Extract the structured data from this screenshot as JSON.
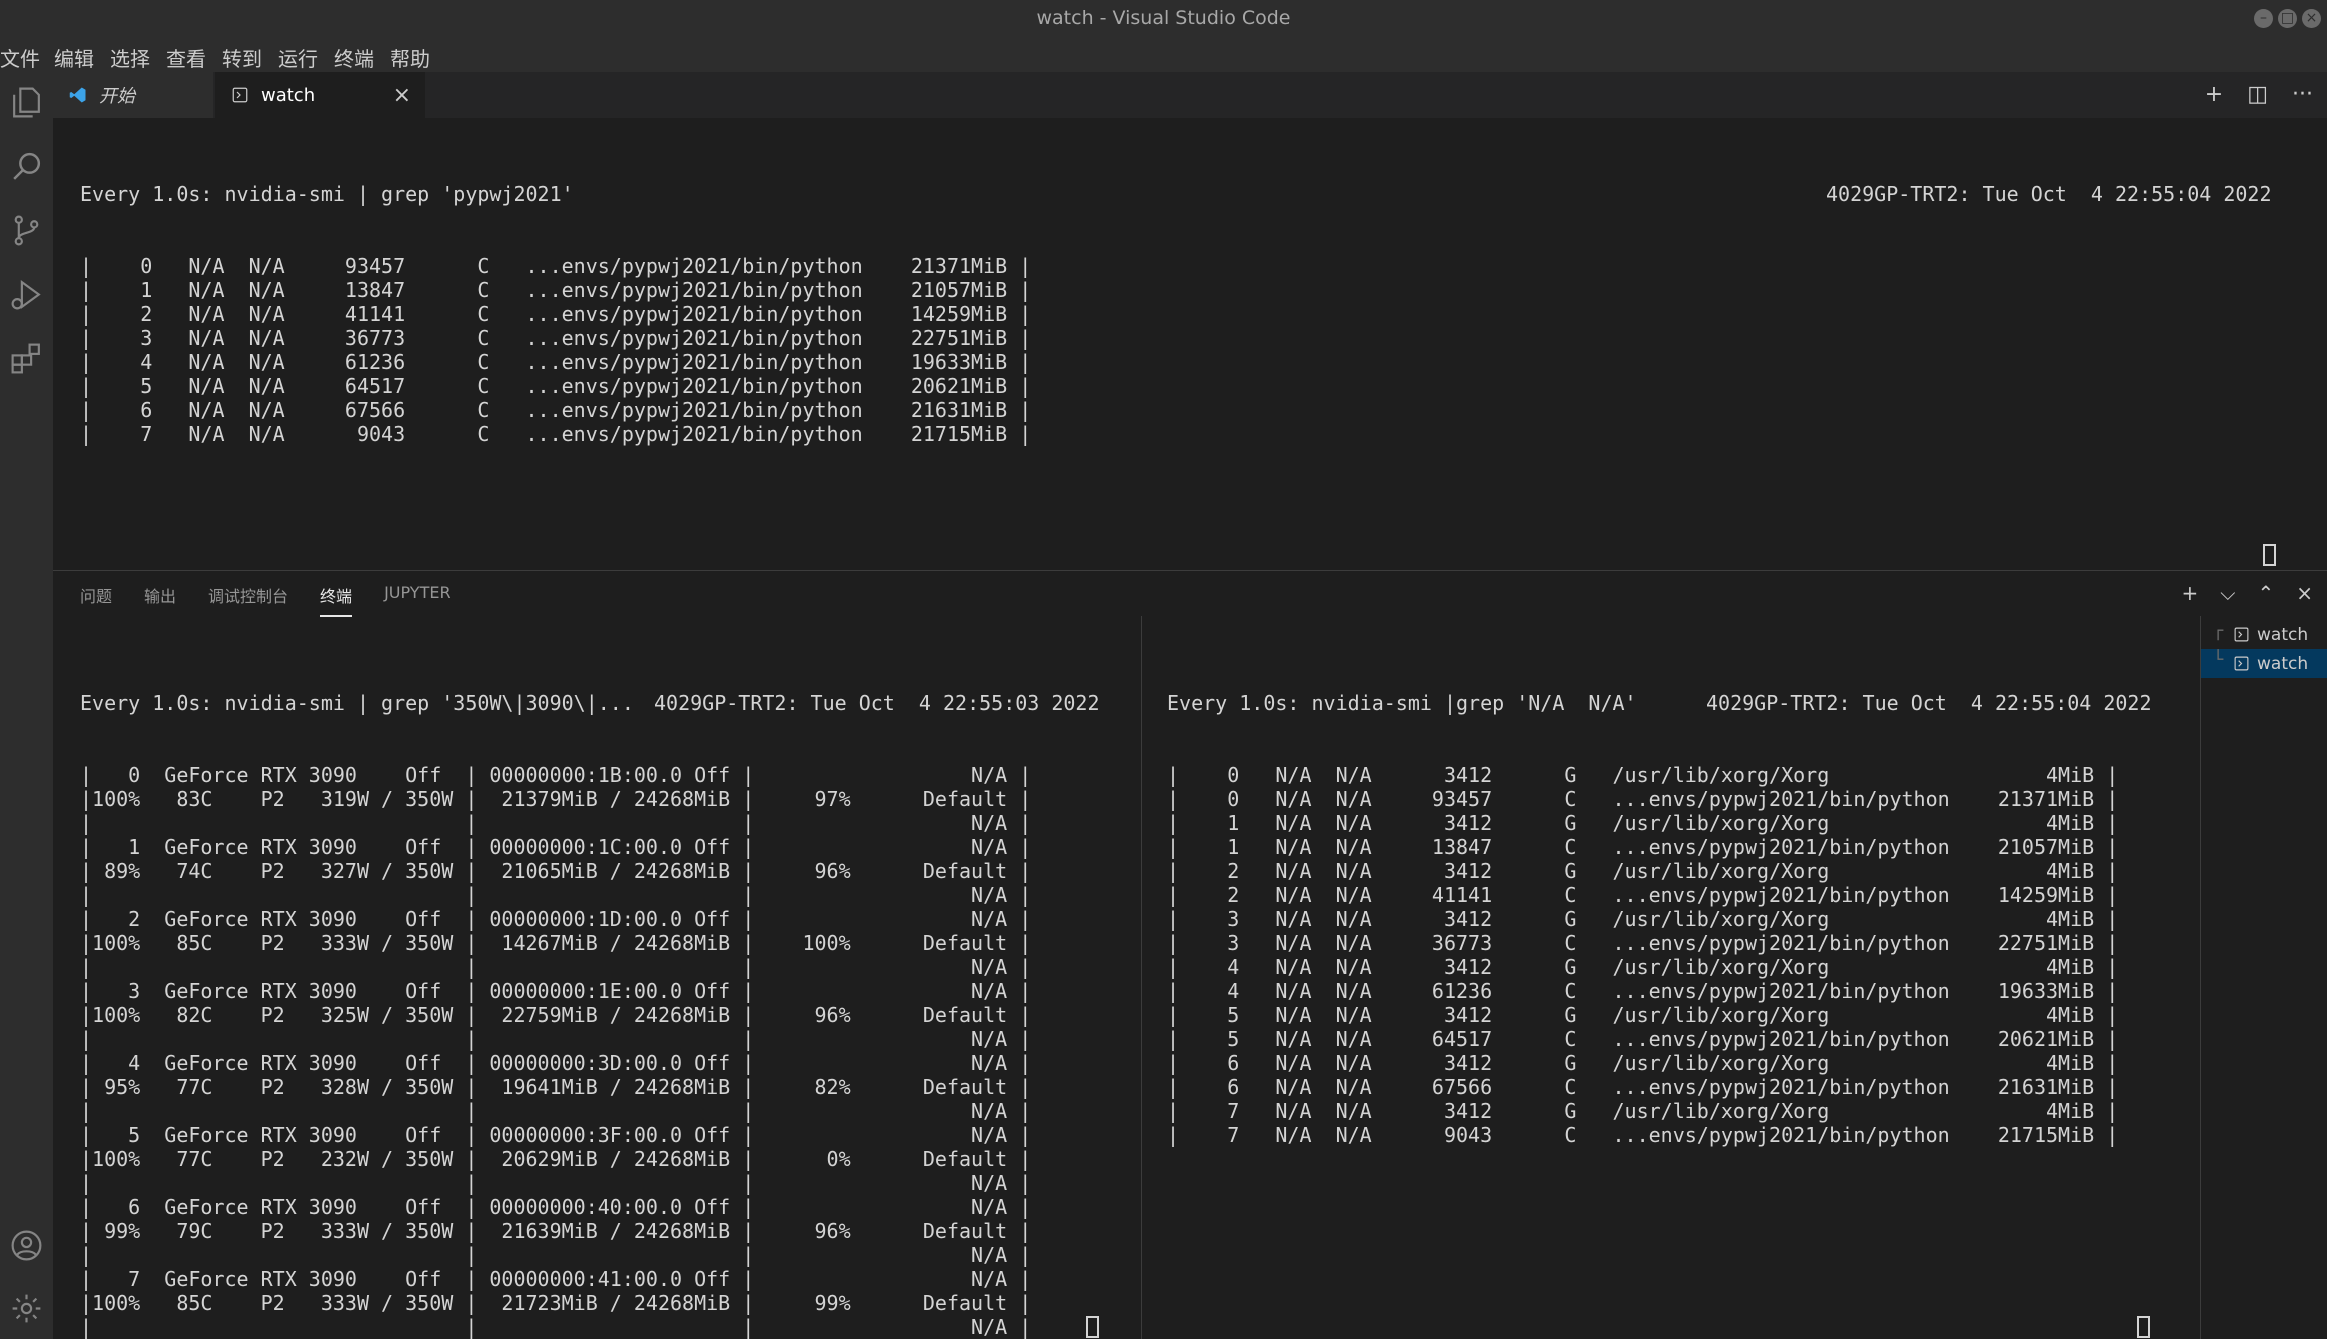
{
  "window": {
    "title": "watch - Visual Studio Code"
  },
  "menu": [
    "文件",
    "编辑",
    "选择",
    "查看",
    "转到",
    "运行",
    "终端",
    "帮助"
  ],
  "activity_icons": [
    "files-icon",
    "search-icon",
    "source-control-icon",
    "run-debug-icon",
    "extensions-icon",
    "account-icon",
    "settings-gear-icon"
  ],
  "tabs": {
    "start": "开始",
    "watch": "watch",
    "close_glyph": "×"
  },
  "tabbar_actions": {
    "add": "+",
    "chevron": "⌵",
    "split": "◫",
    "more": "···"
  },
  "editor_terminal": {
    "header_left": "Every 1.0s: nvidia-smi | grep 'pypwj2021'",
    "header_right": "4029GP-TRT2: Tue Oct  4 22:55:04 2022",
    "lines": [
      "|    0   N/A  N/A     93457      C   ...envs/pypwj2021/bin/python    21371MiB |",
      "|    1   N/A  N/A     13847      C   ...envs/pypwj2021/bin/python    21057MiB |",
      "|    2   N/A  N/A     41141      C   ...envs/pypwj2021/bin/python    14259MiB |",
      "|    3   N/A  N/A     36773      C   ...envs/pypwj2021/bin/python    22751MiB |",
      "|    4   N/A  N/A     61236      C   ...envs/pypwj2021/bin/python    19633MiB |",
      "|    5   N/A  N/A     64517      C   ...envs/pypwj2021/bin/python    20621MiB |",
      "|    6   N/A  N/A     67566      C   ...envs/pypwj2021/bin/python    21631MiB |",
      "|    7   N/A  N/A      9043      C   ...envs/pypwj2021/bin/python    21715MiB |"
    ]
  },
  "panel": {
    "tabs": [
      "问题",
      "输出",
      "调试控制台",
      "终端",
      "JUPYTER"
    ],
    "active_tab": "终端",
    "actions": {
      "add": "+",
      "chevron": "⌵",
      "maximize": "⌃",
      "close": "×"
    }
  },
  "left_terminal": {
    "header_left": "Every 1.0s: nvidia-smi | grep '350W\\|3090\\|...",
    "header_right": "4029GP-TRT2: Tue Oct  4 22:55:03 2022",
    "gpus": [
      {
        "l1": "|   0  GeForce RTX 3090    Off  | 00000000:1B:00.0 Off |                  N/A |",
        "l2": "|100%   83C    P2   319W / 350W |  21379MiB / 24268MiB |     97%      Default |"
      },
      {
        "l1": "|   1  GeForce RTX 3090    Off  | 00000000:1C:00.0 Off |                  N/A |",
        "l2": "| 89%   74C    P2   327W / 350W |  21065MiB / 24268MiB |     96%      Default |"
      },
      {
        "l1": "|   2  GeForce RTX 3090    Off  | 00000000:1D:00.0 Off |                  N/A |",
        "l2": "|100%   85C    P2   333W / 350W |  14267MiB / 24268MiB |    100%      Default |"
      },
      {
        "l1": "|   3  GeForce RTX 3090    Off  | 00000000:1E:00.0 Off |                  N/A |",
        "l2": "|100%   82C    P2   325W / 350W |  22759MiB / 24268MiB |     96%      Default |"
      },
      {
        "l1": "|   4  GeForce RTX 3090    Off  | 00000000:3D:00.0 Off |                  N/A |",
        "l2": "| 95%   77C    P2   328W / 350W |  19641MiB / 24268MiB |     82%      Default |"
      },
      {
        "l1": "|   5  GeForce RTX 3090    Off  | 00000000:3F:00.0 Off |                  N/A |",
        "l2": "|100%   77C    P2   232W / 350W |  20629MiB / 24268MiB |      0%      Default |"
      },
      {
        "l1": "|   6  GeForce RTX 3090    Off  | 00000000:40:00.0 Off |                  N/A |",
        "l2": "| 99%   79C    P2   333W / 350W |  21639MiB / 24268MiB |     96%      Default |"
      },
      {
        "l1": "|   7  GeForce RTX 3090    Off  | 00000000:41:00.0 Off |                  N/A |",
        "l2": "|100%   85C    P2   333W / 350W |  21723MiB / 24268MiB |     99%      Default |"
      }
    ],
    "l3": "|                               |                      |                  N/A |"
  },
  "right_terminal": {
    "header_left": "Every 1.0s: nvidia-smi |grep 'N/A  N/A'",
    "header_right": "4029GP-TRT2: Tue Oct  4 22:55:04 2022",
    "lines": [
      "|    0   N/A  N/A      3412      G   /usr/lib/xorg/Xorg                  4MiB |",
      "|    0   N/A  N/A     93457      C   ...envs/pypwj2021/bin/python    21371MiB |",
      "|    1   N/A  N/A      3412      G   /usr/lib/xorg/Xorg                  4MiB |",
      "|    1   N/A  N/A     13847      C   ...envs/pypwj2021/bin/python    21057MiB |",
      "|    2   N/A  N/A      3412      G   /usr/lib/xorg/Xorg                  4MiB |",
      "|    2   N/A  N/A     41141      C   ...envs/pypwj2021/bin/python    14259MiB |",
      "|    3   N/A  N/A      3412      G   /usr/lib/xorg/Xorg                  4MiB |",
      "|    3   N/A  N/A     36773      C   ...envs/pypwj2021/bin/python    22751MiB |",
      "|    4   N/A  N/A      3412      G   /usr/lib/xorg/Xorg                  4MiB |",
      "|    4   N/A  N/A     61236      C   ...envs/pypwj2021/bin/python    19633MiB |",
      "|    5   N/A  N/A      3412      G   /usr/lib/xorg/Xorg                  4MiB |",
      "|    5   N/A  N/A     64517      C   ...envs/pypwj2021/bin/python    20621MiB |",
      "|    6   N/A  N/A      3412      G   /usr/lib/xorg/Xorg                  4MiB |",
      "|    6   N/A  N/A     67566      C   ...envs/pypwj2021/bin/python    21631MiB |",
      "|    7   N/A  N/A      3412      G   /usr/lib/xorg/Xorg                  4MiB |",
      "|    7   N/A  N/A      9043      C   ...envs/pypwj2021/bin/python    21715MiB |"
    ]
  },
  "terminal_list": [
    {
      "label": "watch",
      "selected": false
    },
    {
      "label": "watch",
      "selected": true
    }
  ]
}
